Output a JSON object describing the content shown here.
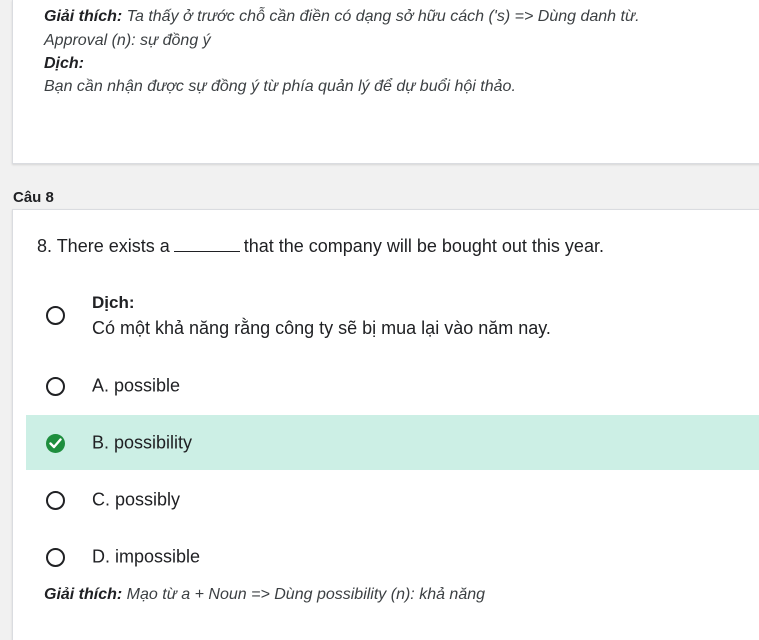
{
  "prev_card": {
    "explanation_label": "Giải thích:",
    "explanation_text": " Ta thấy ở trước chỗ cần điền có dạng sở hữu cách ('s) => Dùng danh từ.",
    "vocab_line": "Approval (n): sự đồng ý",
    "translation_label": "Dịch:",
    "translation_text": "Bạn cần nhận được sự đồng ý từ phía quản lý để dự buổi hội thảo."
  },
  "section_label": "Câu 8",
  "question": {
    "prefix": "8. There exists a",
    "suffix": "that the company will be bought out this year."
  },
  "translation_option": {
    "title": "Dịch:",
    "text": "Có một khả năng rằng công ty sẽ bị mua lại vào năm nay."
  },
  "options": [
    {
      "label": "A. possible",
      "selected": false
    },
    {
      "label": "B. possibility",
      "selected": true
    },
    {
      "label": "C. possibly",
      "selected": false
    },
    {
      "label": "D. impossible",
      "selected": false
    }
  ],
  "final_explanation": {
    "label": "Giải thích:",
    "text": " Mạo từ a + Noun => Dùng possibility (n): khả năng"
  },
  "colors": {
    "selected_bg": "#ccefe5",
    "check_green": "#1e8e3e"
  }
}
